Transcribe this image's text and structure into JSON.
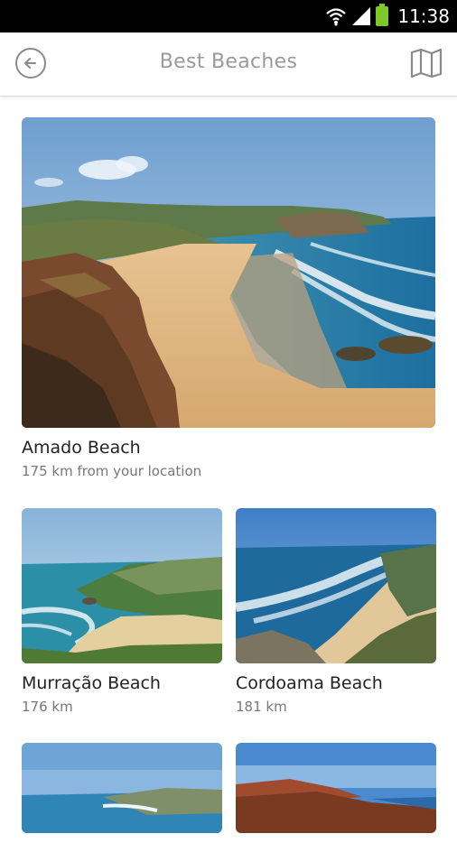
{
  "status_bar": {
    "time": "11:38",
    "icons": [
      "wifi-icon",
      "signal-icon",
      "battery-icon"
    ]
  },
  "app_bar": {
    "title": "Best Beaches",
    "back_icon": "back-circle-icon",
    "map_icon": "map-icon"
  },
  "beaches": [
    {
      "name": "Amado Beach",
      "distance": "175 km from your location"
    },
    {
      "name": "Murração Beach",
      "distance": "176 km"
    },
    {
      "name": "Cordoama Beach",
      "distance": "181 km"
    },
    {
      "name": "",
      "distance": ""
    },
    {
      "name": "",
      "distance": ""
    }
  ],
  "colors": {
    "title": "#9a9a9a",
    "icon_gray": "#8a8a8a",
    "battery_green": "#7ec92a"
  }
}
